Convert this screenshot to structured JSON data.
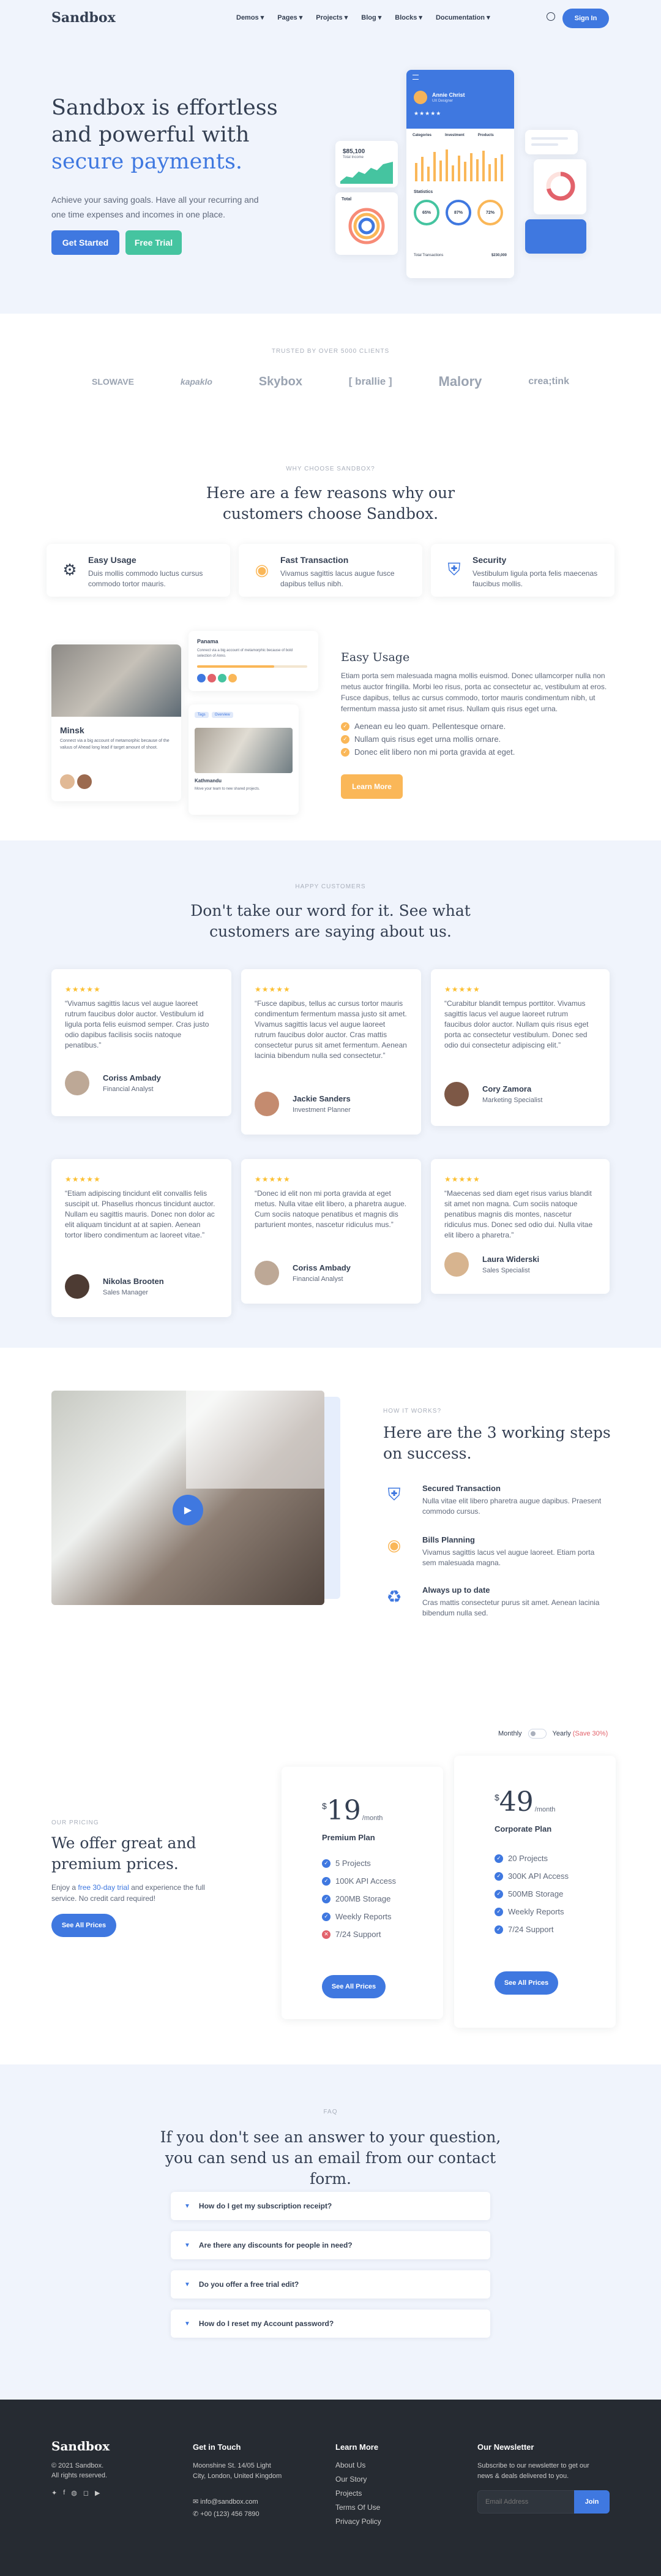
{
  "nav": {
    "brand": "Sandbox",
    "items": [
      "Demos",
      "Pages",
      "Projects",
      "Blog",
      "Blocks",
      "Documentation"
    ],
    "signin": "Sign In"
  },
  "hero": {
    "title_line1": "Sandbox is effortless",
    "title_line2": "and powerful with",
    "title_accent": "secure payments.",
    "lead": "Achieve your saving goals. Have all your recurring and one time expenses and incomes in one place.",
    "cta_primary": "Get Started",
    "cta_secondary": "Free Trial",
    "mock": {
      "user_name": "Annie Christ",
      "user_role": "UX Designer",
      "stat1_value": "$85,100",
      "stat1_label": "Total Income",
      "tab_categories": "Categories",
      "tab_investment": "Investment",
      "tab_products": "Products",
      "label_statistics": "Statistics",
      "label_total": "Total",
      "label_total_transactions": "Total Transactions",
      "total_transactions_value": "$230,000",
      "pct1": "65%",
      "pct2": "87%",
      "pct3": "72%"
    }
  },
  "clients": {
    "eyebrow": "TRUSTED BY OVER 5000 CLIENTS",
    "logos": [
      "SLOWAVE",
      "kapaklo",
      "Skybox",
      "[ brallie ]",
      "Malory",
      "crea;tink"
    ]
  },
  "reasons": {
    "eyebrow": "WHY CHOOSE SANDBOX?",
    "title": "Here are a few reasons why our customers choose Sandbox.",
    "items": [
      {
        "title": "Easy Usage",
        "text": "Duis mollis commodo luctus cursus commodo tortor mauris."
      },
      {
        "title": "Fast Transaction",
        "text": "Vivamus sagittis lacus augue fusce dapibus tellus nibh."
      },
      {
        "title": "Security",
        "text": "Vestibulum ligula porta felis maecenas faucibus mollis."
      }
    ]
  },
  "usage": {
    "title": "Easy Usage",
    "text": "Etiam porta sem malesuada magna mollis euismod. Donec ullamcorper nulla non metus auctor fringilla. Morbi leo risus, porta ac consectetur ac, vestibulum at eros. Fusce dapibus, tellus ac cursus commodo, tortor mauris condimentum nibh, ut fermentum massa justo sit amet risus. Nullam quis risus eget urna.",
    "bullets": [
      "Aenean eu leo quam. Pellentesque ornare.",
      "Nullam quis risus eget urna mollis ornare.",
      "Donec elit libero non mi porta gravida at eget."
    ],
    "button": "Learn More",
    "card_minsk_title": "Minsk",
    "card_minsk_text": "Connect via a big account of metamorphic because of the valuus of Ahead long lead if target amount of shoot.",
    "card_panama_title": "Panama",
    "card_panama_text": "Connect via a big account of metamorphic because of bold selection of Anno.",
    "card_kath_title": "Kathmandu",
    "card_kath_text": "Move your team to new shared projects.",
    "tag1": "Tags",
    "tag2": "Overview"
  },
  "testimonials": {
    "eyebrow": "HAPPY CUSTOMERS",
    "title": "Don't take our word for it. See what customers are saying about us.",
    "items": [
      {
        "stars": "★★★★★",
        "quote": "“Vivamus sagittis lacus vel augue laoreet rutrum faucibus dolor auctor. Vestibulum id ligula porta felis euismod semper. Cras justo odio dapibus facilisis sociis natoque penatibus.”",
        "name": "Coriss Ambady",
        "role": "Financial Analyst"
      },
      {
        "stars": "★★★★★",
        "quote": "“Fusce dapibus, tellus ac cursus tortor mauris condimentum fermentum massa justo sit amet. Vivamus sagittis lacus vel augue laoreet rutrum faucibus dolor auctor. Cras mattis consectetur purus sit amet fermentum. Aenean lacinia bibendum nulla sed consectetur.”",
        "name": "Jackie Sanders",
        "role": "Investment Planner"
      },
      {
        "stars": "★★★★★",
        "quote": "“Curabitur blandit tempus porttitor. Vivamus sagittis lacus vel augue laoreet rutrum faucibus dolor auctor. Nullam quis risus eget porta ac consectetur vestibulum. Donec sed odio dui consectetur adipiscing elit.”",
        "name": "Cory Zamora",
        "role": "Marketing Specialist"
      },
      {
        "stars": "★★★★★",
        "quote": "“Etiam adipiscing tincidunt elit convallis felis suscipit ut. Phasellus rhoncus tincidunt auctor. Nullam eu sagittis mauris. Donec non dolor ac elit aliquam tincidunt at at sapien. Aenean tortor libero condimentum ac laoreet vitae.”",
        "name": "Nikolas Brooten",
        "role": "Sales Manager"
      },
      {
        "stars": "★★★★★",
        "quote": "“Donec id elit non mi porta gravida at eget metus. Nulla vitae elit libero, a pharetra augue. Cum sociis natoque penatibus et magnis dis parturient montes, nascetur ridiculus mus.”",
        "name": "Coriss Ambady",
        "role": "Financial Analyst"
      },
      {
        "stars": "★★★★★",
        "quote": "“Maecenas sed diam eget risus varius blandit sit amet non magna. Cum sociis natoque penatibus magnis dis montes, nascetur ridiculus mus. Donec sed odio dui. Nulla vitae elit libero a pharetra.”",
        "name": "Laura Widerski",
        "role": "Sales Specialist"
      }
    ]
  },
  "steps": {
    "eyebrow": "HOW IT WORKS?",
    "title": "Here are the 3 working steps on success.",
    "items": [
      {
        "title": "Secured Transaction",
        "text": "Nulla vitae elit libero pharetra augue dapibus. Praesent commodo cursus."
      },
      {
        "title": "Bills Planning",
        "text": "Vivamus sagittis lacus vel augue laoreet. Etiam porta sem malesuada magna."
      },
      {
        "title": "Always up to date",
        "text": "Cras mattis consectetur purus sit amet. Aenean lacinia bibendum nulla sed."
      }
    ]
  },
  "pricing": {
    "eyebrow": "OUR PRICING",
    "title": "We offer great and premium prices.",
    "lead_pre": "Enjoy a ",
    "lead_link": "free 30-day trial",
    "lead_post": " and experience the full service. No credit card required!",
    "button": "See All Prices",
    "toggle_monthly": "Monthly",
    "toggle_yearly": "Yearly",
    "toggle_save": "(Save 30%)",
    "plans": [
      {
        "currency": "$",
        "price": "19",
        "period": "/month",
        "name": "Premium Plan",
        "features": [
          {
            "text": "5 Projects",
            "on": true
          },
          {
            "text": "100K API Access",
            "on": true
          },
          {
            "text": "200MB Storage",
            "on": true
          },
          {
            "text": "Weekly Reports",
            "on": true
          },
          {
            "text": "7/24 Support",
            "on": false
          }
        ],
        "button": "See All Prices"
      },
      {
        "currency": "$",
        "price": "49",
        "period": "/month",
        "name": "Corporate Plan",
        "features": [
          {
            "text": "20 Projects",
            "on": true
          },
          {
            "text": "300K API Access",
            "on": true
          },
          {
            "text": "500MB Storage",
            "on": true
          },
          {
            "text": "Weekly Reports",
            "on": true
          },
          {
            "text": "7/24 Support",
            "on": true
          }
        ],
        "button": "See All Prices"
      }
    ]
  },
  "faq": {
    "eyebrow": "FAQ",
    "title": "If you don't see an answer to your question, you can send us an email from our contact form.",
    "items": [
      "How do I get my subscription receipt?",
      "Are there any discounts for people in need?",
      "Do you offer a free trial edit?",
      "How do I reset my Account password?"
    ]
  },
  "footer": {
    "brand": "Sandbox",
    "copy1": "© 2021 Sandbox.",
    "copy2": "All rights reserved.",
    "touch_title": "Get in Touch",
    "address": "Moonshine St. 14/05 Light City, London, United Kingdom",
    "email": "info@sandbox.com",
    "phone": "+00 (123) 456 7890",
    "learn_title": "Learn More",
    "links": [
      "About Us",
      "Our Story",
      "Projects",
      "Terms Of Use",
      "Privacy Policy"
    ],
    "news_title": "Our Newsletter",
    "news_text": "Subscribe to our newsletter to get our news & deals delivered to you.",
    "email_placeholder": "Email Address",
    "join": "Join"
  },
  "colors": {
    "primary": "#3f78e0",
    "green": "#45c4a0",
    "yellow": "#fab758",
    "dark": "#262b32",
    "bg": "#f0f4fc"
  }
}
